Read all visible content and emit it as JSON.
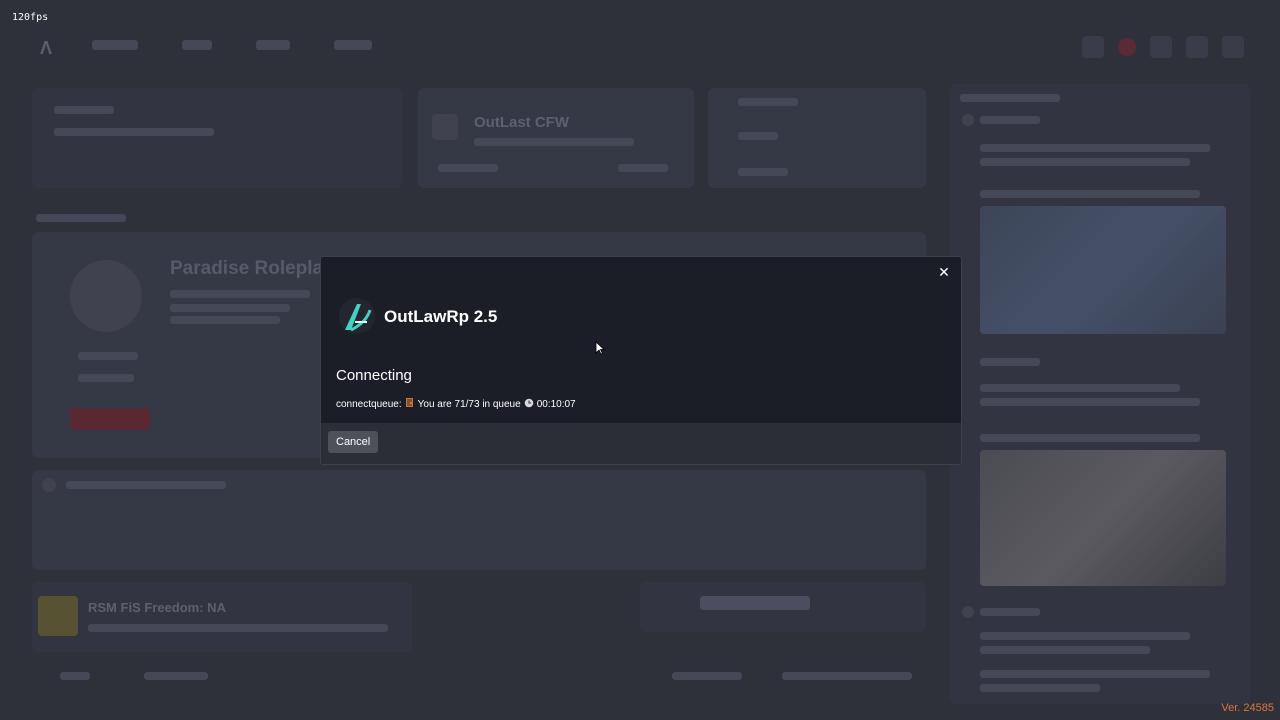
{
  "overlay": {
    "fps": "120fps",
    "version": "Ver. 24585"
  },
  "background": {
    "featured_server": "OutLast CFW",
    "server_title": "Paradise Roleplay",
    "bottom_server": "RSM FiS Freedom: NA"
  },
  "modal": {
    "server_name": "OutLawRp 2.5",
    "status": "Connecting",
    "queue_prefix": "connectqueue:",
    "queue_icon": "door-icon",
    "queue_text": "You are 71/73 in queue",
    "clock_icon": "clock-icon",
    "queue_time": "00:10:07",
    "cancel_label": "Cancel",
    "close_glyph": "✕"
  },
  "colors": {
    "accent_logo": "#3fd3c3",
    "version_text": "#e0733a",
    "modal_bg": "#1c1e27",
    "modal_footer": "#2c2e37"
  }
}
